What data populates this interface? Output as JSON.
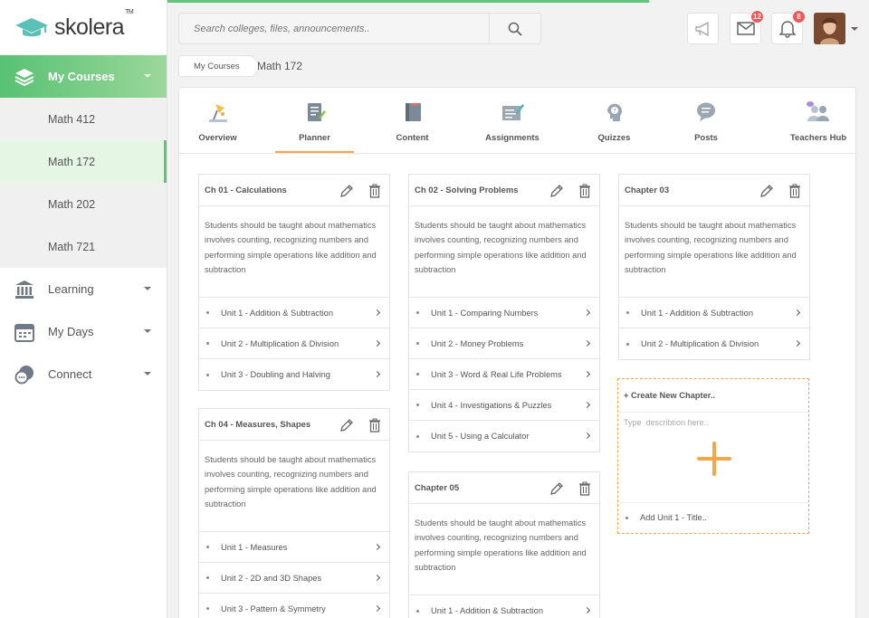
{
  "brand": {
    "name": "skolera",
    "tm": "TM"
  },
  "sidebar": {
    "my_courses": "My Courses",
    "courses": [
      "Math 412",
      "Math 172",
      "Math 202",
      "Math 721"
    ],
    "learning": "Learning",
    "my_days": "My Days",
    "connect": "Connect"
  },
  "topbar": {
    "search_placeholder": "Search colleges, files, announcements..",
    "messages_count": "12",
    "notifications_count": "8"
  },
  "breadcrumb": {
    "parent": "My Courses",
    "current": "Math 172"
  },
  "tabs": [
    "Overview",
    "Planner",
    "Content",
    "Assignments",
    "Quizzes",
    "Posts",
    "Teachers Hub"
  ],
  "chapters": {
    "ch01": {
      "title": "Ch 01 - Calculations",
      "desc": "Students should be taught about mathematics involves counting, recognizing numbers and performing simple operations like addition and subtraction",
      "units": [
        "Unit 1 - Addition & Subtraction",
        "Unit 2 - Multiplication & Division",
        "Unit 3 - Doubling and Halving"
      ]
    },
    "ch02": {
      "title": "Ch 02 - Solving Problems",
      "desc": "Students should be taught about mathematics involves counting, recognizing numbers and performing simple operations like addition and subtraction",
      "units": [
        "Unit 1 - Comparing Numbers",
        "Unit 2 - Money Problems",
        "Unit 3 - Word & Real Life Problems",
        "Unit 4 - Investigations & Puzzles",
        "Unit 5 - Using a Calculator"
      ]
    },
    "ch03": {
      "title": "Chapter 03",
      "desc": "Students should be taught about mathematics involves counting, recognizing numbers and performing simple operations like addition and subtraction",
      "units": [
        "Unit 1 - Addition & Subtraction",
        "Unit 2 - Multiplication & Division"
      ]
    },
    "ch04": {
      "title": "Ch 04 - Measures, Shapes",
      "desc": "Students should be taught about mathematics involves counting, recognizing numbers and performing simple operations like addition and subtraction",
      "units": [
        "Unit 1 - Measures",
        "Unit 2 - 2D and 3D Shapes",
        "Unit 3 - Pattern & Symmetry"
      ]
    },
    "ch05": {
      "title": "Chapter 05",
      "desc": "Students should be taught about mathematics involves counting, recognizing numbers and performing simple operations like addition and subtraction",
      "units": [
        "Unit 1 - Addition & Subtraction"
      ]
    }
  },
  "new_chapter": {
    "title": "+  Create New Chapter..",
    "desc_placeholder": "Type  describtion here..",
    "unit_placeholder": "Add Unit 1 - Title.."
  },
  "colors": {
    "green": "#5fc37a",
    "orange": "#f4a64a",
    "badge": "#f05757"
  }
}
